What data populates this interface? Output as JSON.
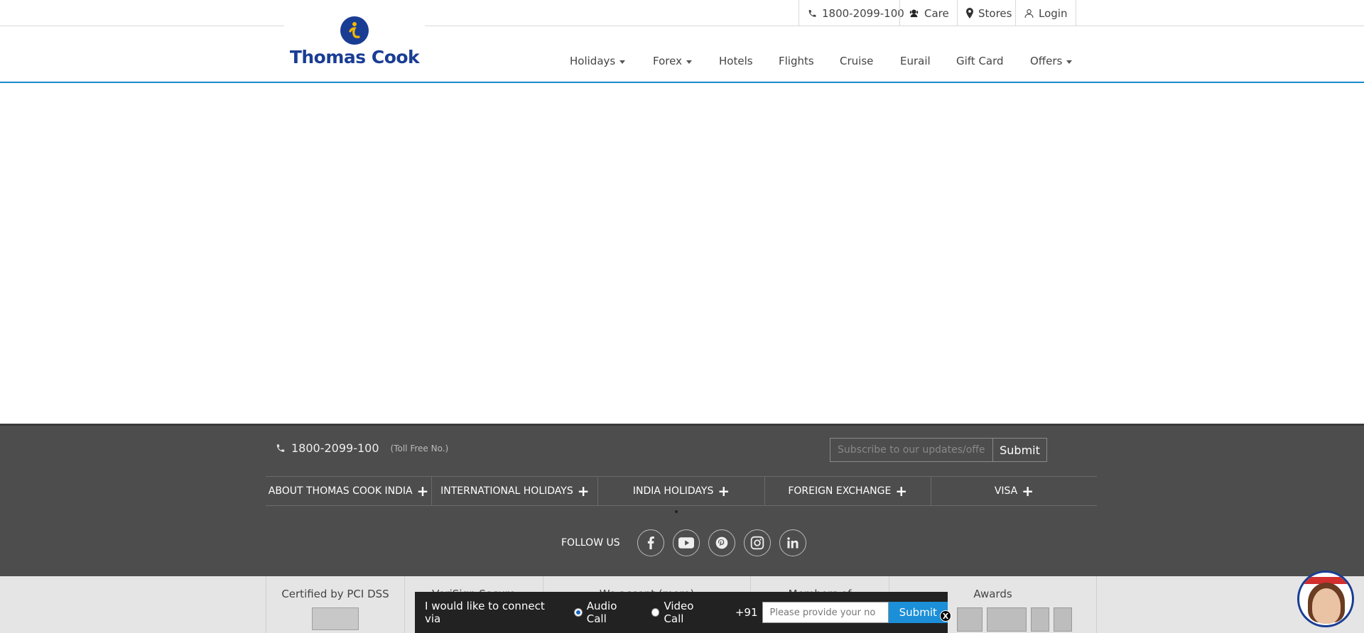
{
  "brand": {
    "logo_text": "Thomas Cook",
    "color": "#1a3d94",
    "accent": "#1b8bd0"
  },
  "utility_bar": {
    "phone": "1800-2099-100",
    "care": "Care",
    "stores": "Stores",
    "login": "Login"
  },
  "nav": {
    "items": [
      {
        "label": "Holidays",
        "dropdown": true
      },
      {
        "label": "Forex",
        "dropdown": true
      },
      {
        "label": "Hotels",
        "dropdown": false
      },
      {
        "label": "Flights",
        "dropdown": false
      },
      {
        "label": "Cruise",
        "dropdown": false
      },
      {
        "label": "Eurail",
        "dropdown": false
      },
      {
        "label": "Gift Card",
        "dropdown": false
      },
      {
        "label": "Offers",
        "dropdown": true
      }
    ]
  },
  "footer": {
    "phone": "1800-2099-100",
    "toll_free": "(Toll Free No.)",
    "subscribe_placeholder": "Subscribe to our updates/offers",
    "subscribe_button": "Submit",
    "sections": [
      "ABOUT THOMAS COOK INDIA",
      "INTERNATIONAL HOLIDAYS",
      "INDIA HOLIDAYS",
      "FOREIGN EXCHANGE",
      "VISA"
    ],
    "follow_us": "FOLLOW US",
    "social_icons": [
      "facebook-icon",
      "youtube-icon",
      "pinterest-icon",
      "instagram-icon",
      "linkedin-icon"
    ],
    "certifications": [
      {
        "title": "Certified by PCI DSS"
      },
      {
        "title": "VeriSign Secure"
      },
      {
        "title": "We accept (more)"
      },
      {
        "title": "Members of"
      },
      {
        "title": "Awards"
      }
    ]
  },
  "connect_bar": {
    "label": "I would like to connect via",
    "options": [
      {
        "label": "Audio Call",
        "selected": true
      },
      {
        "label": "Video Call",
        "selected": false
      }
    ],
    "country_code": "+91",
    "placeholder": "Please provide your no",
    "submit": "Submit",
    "close": "X"
  }
}
